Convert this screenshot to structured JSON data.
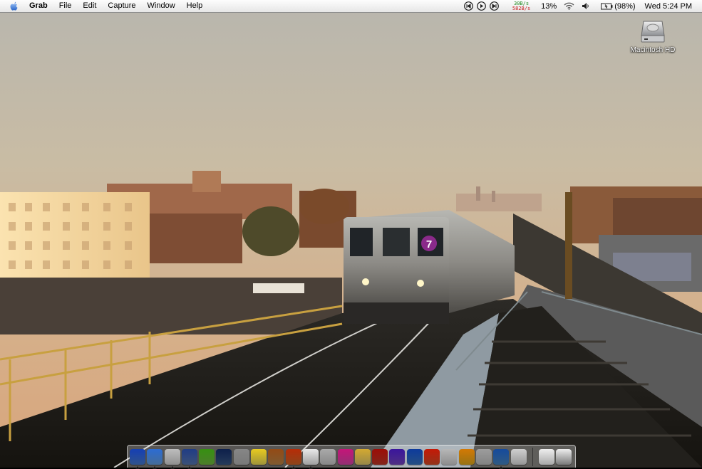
{
  "menubar": {
    "app_name": "Grab",
    "menus": [
      "File",
      "Edit",
      "Capture",
      "Window",
      "Help"
    ],
    "network": {
      "upload": "30B/s",
      "download": "582B/s"
    },
    "cpu_percent": "13%",
    "battery": "(98%)",
    "clock": "Wed 5:24 PM"
  },
  "desktop": {
    "icons": [
      {
        "label": "Macintosh HD",
        "icon": "hard-drive-icon"
      }
    ]
  },
  "dock": {
    "apps": [
      {
        "icon": "finder-icon",
        "color": "#4a7fd6",
        "running": true
      },
      {
        "icon": "safari-icon",
        "color": "#6aa6e8",
        "running": true
      },
      {
        "icon": "script-editor-icon",
        "color": "#dcdcdc",
        "running": true
      },
      {
        "icon": "preview-icon",
        "color": "#5b7cb8",
        "running": true
      },
      {
        "icon": "itunes-icon",
        "color": "#76c043",
        "running": false
      },
      {
        "icon": "network-icon",
        "color": "#3a5a8a",
        "running": false
      },
      {
        "icon": "spotlight-icon",
        "color": "#b9b9b9",
        "running": false
      },
      {
        "icon": "stickies-icon",
        "color": "#f3e35a",
        "running": false
      },
      {
        "icon": "iphoto-icon",
        "color": "#c28a4a",
        "running": false
      },
      {
        "icon": "firefox-icon",
        "color": "#d86a2a",
        "running": true
      },
      {
        "icon": "ical-icon",
        "color": "#f4f4f4",
        "running": true
      },
      {
        "icon": "textedit-icon",
        "color": "#d0d0d0",
        "running": false
      },
      {
        "icon": "flower-app-icon",
        "color": "#e04ab0",
        "running": false
      },
      {
        "icon": "pages-icon",
        "color": "#e8d070",
        "running": false
      },
      {
        "icon": "mail-icon",
        "color": "#c83a2a",
        "running": false
      },
      {
        "icon": "internet-explorer-icon",
        "color": "#7a4ac8",
        "running": false
      },
      {
        "icon": "word-icon",
        "color": "#3a7ac8",
        "running": false
      },
      {
        "icon": "powerpoint-icon",
        "color": "#e0502a",
        "running": false
      },
      {
        "icon": "apple-store-icon",
        "color": "#d8d8d8",
        "running": false
      },
      {
        "icon": "directions-icon",
        "color": "#e8b020",
        "running": false
      },
      {
        "icon": "pin-icon",
        "color": "#c8c8c8",
        "running": false
      },
      {
        "icon": "image-capture-icon",
        "color": "#4a8ac8",
        "running": true
      },
      {
        "icon": "letter-icon",
        "color": "#e6e6e6",
        "running": false
      }
    ],
    "trailing": [
      {
        "icon": "documents-stack-icon",
        "color": "#a8a8a8"
      },
      {
        "icon": "trash-icon",
        "color": "#7a7a7a"
      }
    ]
  }
}
